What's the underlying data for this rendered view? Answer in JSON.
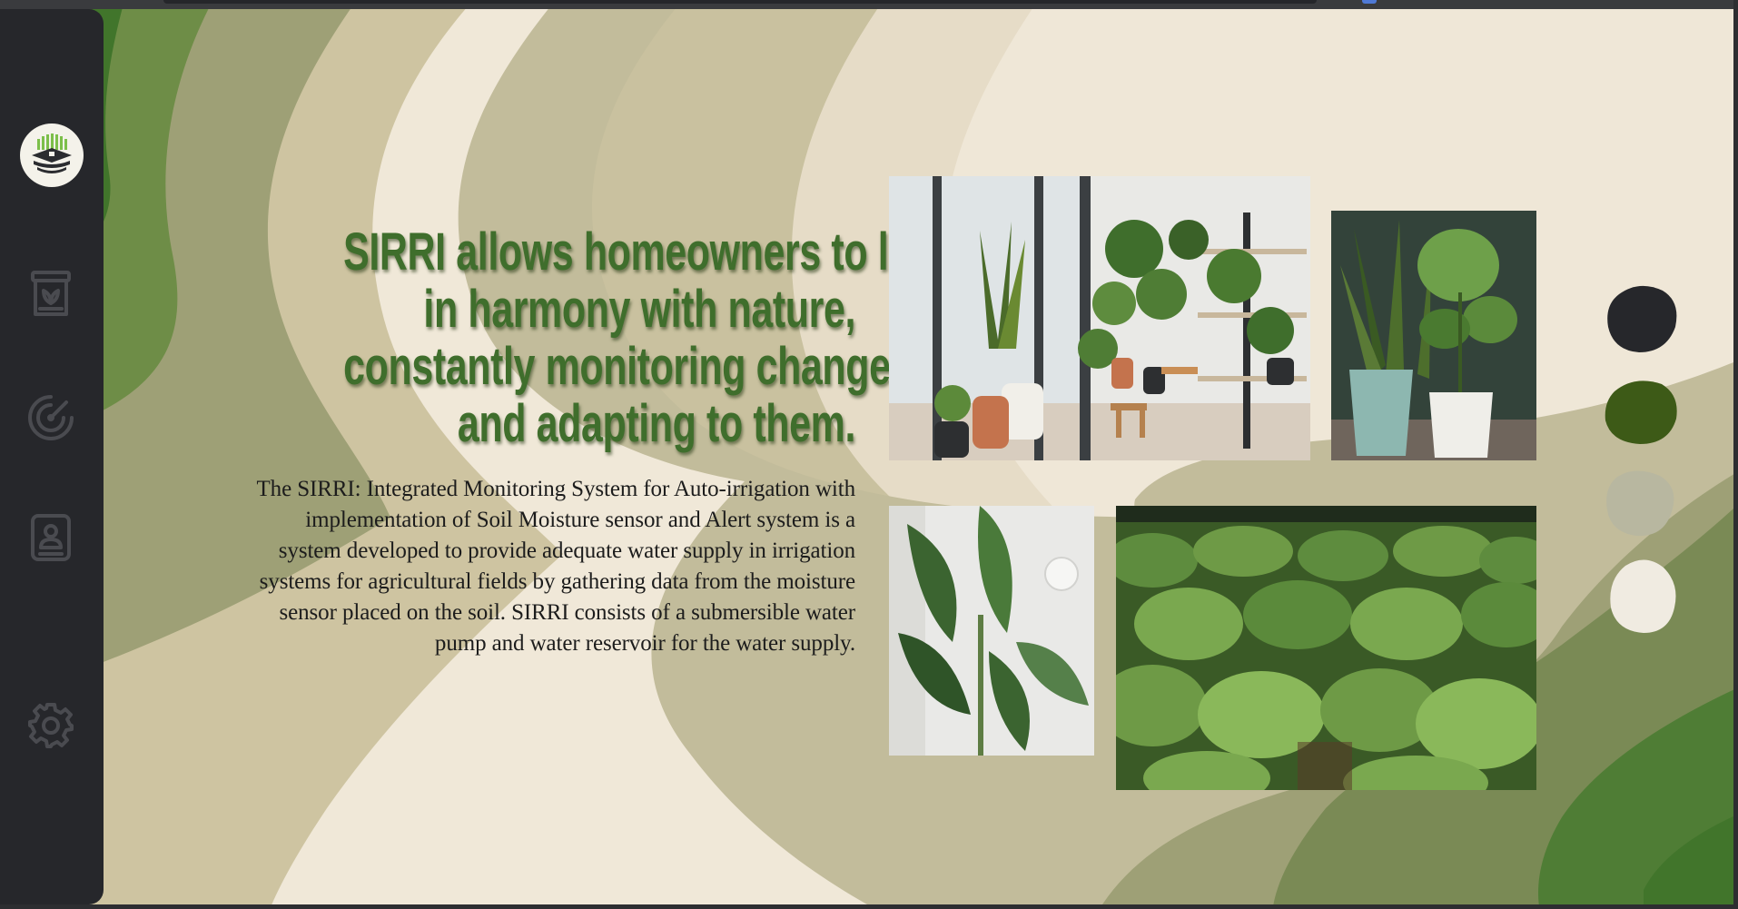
{
  "hero": {
    "headline_lines": [
      "SIRRI allows homeowners to live",
      "in harmony with nature,",
      "constantly monitoring changes",
      "and adapting to them."
    ],
    "description": "The SIRRI: Integrated Monitoring System for Auto-irrigation with implementation of Soil Moisture sensor and Alert system is a system developed to provide adequate water supply in irrigation systems for agricultural fields by gathering data from the moisture sensor placed on the soil. SIRRI consists of a submersible water pump and water reservoir for the water supply."
  },
  "sidebar": {
    "logo": "sirri-logo",
    "items": [
      {
        "icon": "plant-pot-icon"
      },
      {
        "icon": "gauge-icon"
      },
      {
        "icon": "profile-card-icon"
      },
      {
        "icon": "gear-icon"
      }
    ]
  },
  "gallery": [
    {
      "subject": "indoor-plants-room-photo"
    },
    {
      "subject": "potted-plants-photo"
    },
    {
      "subject": "banana-leaf-plant-photo"
    },
    {
      "subject": "tobacco-field-photo"
    }
  ],
  "palette": [
    "#26272b",
    "#3d5a17",
    "#b8b7a0",
    "#f0ebe1"
  ],
  "theme": {
    "sidebar_bg": "#26272b",
    "headline_color": "#3f6e2c",
    "page_bg": "#efe7d7"
  }
}
